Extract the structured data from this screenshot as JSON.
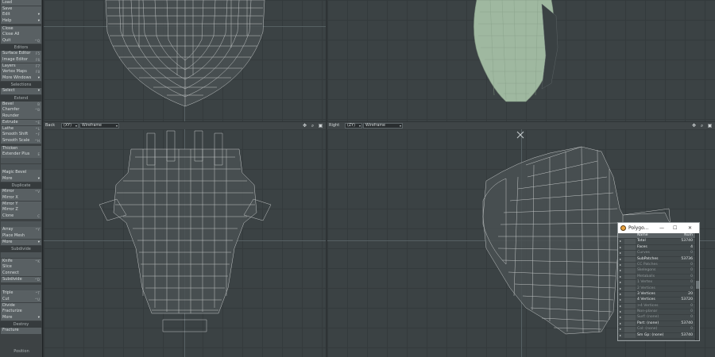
{
  "sidebar": {
    "groups": [
      {
        "items": [
          {
            "label": "Load",
            "shortcut": ""
          },
          {
            "label": "Save",
            "shortcut": ""
          },
          {
            "label": "Edit",
            "shortcut": "",
            "dropdown": true
          },
          {
            "label": "Help",
            "shortcut": "",
            "dropdown": true
          }
        ]
      },
      {
        "gap": true,
        "items": [
          {
            "label": "Close",
            "shortcut": ""
          },
          {
            "label": "Close All",
            "shortcut": ""
          },
          {
            "label": "Quit",
            "shortcut": "^Q"
          }
        ]
      },
      {
        "header": "Editors",
        "items": [
          {
            "label": "Surface Editor",
            "shortcut": "F5"
          },
          {
            "label": "Image Editor",
            "shortcut": "F6"
          },
          {
            "label": "Layers",
            "shortcut": "F7"
          },
          {
            "label": "Vertex Maps",
            "shortcut": "F8"
          },
          {
            "label": "More Windows",
            "shortcut": "",
            "dropdown": true
          }
        ]
      },
      {
        "header": "Selections",
        "items": [
          {
            "label": "Select",
            "shortcut": "",
            "dropdown": true
          }
        ]
      },
      {
        "header": "Extend",
        "items": [
          {
            "label": "Bevel",
            "shortcut": "B"
          },
          {
            "label": "Chamfer",
            "shortcut": "^B"
          },
          {
            "label": "Rounder",
            "shortcut": ""
          },
          {
            "label": "Extrude",
            "shortcut": "^E"
          },
          {
            "label": "Lathe",
            "shortcut": "^L"
          },
          {
            "label": "Smooth Shift",
            "shortcut": "^F"
          },
          {
            "label": "Smooth Scale",
            "shortcut": "^H"
          }
        ]
      },
      {
        "gap": true,
        "items": [
          {
            "label": "Thicken",
            "shortcut": ""
          },
          {
            "label": "Extender Plus",
            "shortcut": "E"
          },
          {
            "label": "",
            "shortcut": "",
            "dim": true
          },
          {
            "label": "",
            "shortcut": "",
            "dim": true
          },
          {
            "label": "Magic Bevel",
            "shortcut": ""
          },
          {
            "label": "More",
            "shortcut": "",
            "dropdown": true
          }
        ]
      },
      {
        "header": "Duplicate",
        "items": [
          {
            "label": "Mirror",
            "shortcut": "^V"
          },
          {
            "label": "Mirror X",
            "shortcut": ""
          },
          {
            "label": "Mirror Y",
            "shortcut": ""
          },
          {
            "label": "Mirror Z",
            "shortcut": ""
          },
          {
            "label": "Clone",
            "shortcut": "C"
          }
        ]
      },
      {
        "gap": true,
        "items": [
          {
            "label": "",
            "shortcut": "",
            "dim": true
          },
          {
            "label": "Array",
            "shortcut": "^Y"
          },
          {
            "label": "Place Mesh",
            "shortcut": ""
          },
          {
            "label": "More",
            "shortcut": "",
            "dropdown": true
          }
        ]
      },
      {
        "header": "Subdivide",
        "items": [
          {
            "label": "",
            "shortcut": "",
            "dim": true
          },
          {
            "label": "Knife",
            "shortcut": "^K"
          },
          {
            "label": "Slice",
            "shortcut": ""
          },
          {
            "label": "Connect",
            "shortcut": ""
          },
          {
            "label": "Subdivide",
            "shortcut": "^D"
          }
        ]
      },
      {
        "gap": true,
        "items": [
          {
            "label": "",
            "shortcut": "",
            "dim": true
          },
          {
            "label": "Triple",
            "shortcut": "^T"
          },
          {
            "label": "Cut",
            "shortcut": "^U"
          },
          {
            "label": "Divide",
            "shortcut": ""
          },
          {
            "label": "Fracturize",
            "shortcut": ""
          },
          {
            "label": "More",
            "shortcut": "",
            "dropdown": true
          }
        ]
      },
      {
        "header": "Destroy",
        "items": [
          {
            "label": "Fracture",
            "shortcut": ""
          }
        ]
      }
    ],
    "bottom_label": "Position"
  },
  "viewport_headers": {
    "left": {
      "view": "Back",
      "axis": "(XY)",
      "mode": "Wireframe"
    },
    "right": {
      "view": "Right",
      "axis": "(ZY)",
      "mode": "Wireframe"
    }
  },
  "poly_panel": {
    "title": "Polygo...",
    "columns": {
      "name": "Name",
      "num": "Num"
    },
    "rows": [
      {
        "name": "Total",
        "num": "53740",
        "dim": false
      },
      {
        "name": "Faces",
        "num": "4",
        "dim": false
      },
      {
        "name": "Curves",
        "num": "0",
        "dim": true
      },
      {
        "name": "SubPatches",
        "num": "53736",
        "dim": false
      },
      {
        "name": "CC Patches",
        "num": "0",
        "dim": true
      },
      {
        "name": "Skelegons",
        "num": "0",
        "dim": true
      },
      {
        "name": "Metaballs",
        "num": "0",
        "dim": true
      },
      {
        "name": "1 Vertex",
        "num": "0",
        "dim": true
      },
      {
        "name": "2 Vertices",
        "num": "0",
        "dim": true
      },
      {
        "name": "3 Vertices",
        "num": "20",
        "dim": false
      },
      {
        "name": "4 Vertices",
        "num": "53720",
        "dim": false
      },
      {
        "name": ">4 Vertices",
        "num": "0",
        "dim": true
      },
      {
        "name": "Non-planar",
        "num": "0",
        "dim": true
      },
      {
        "name": "Surf: (none)",
        "num": "0",
        "dim": true
      },
      {
        "name": "Part: (none)",
        "num": "53740",
        "dim": false
      },
      {
        "name": "Col: (none)",
        "num": "0",
        "dim": true
      },
      {
        "name": "Sm Gp: (none)",
        "num": "53740",
        "dim": false
      }
    ]
  },
  "colors": {
    "viewport_bg": "#3b4244",
    "mesh_wire": "#d9dcdc",
    "mesh_shaded": "#9fb8a0"
  }
}
